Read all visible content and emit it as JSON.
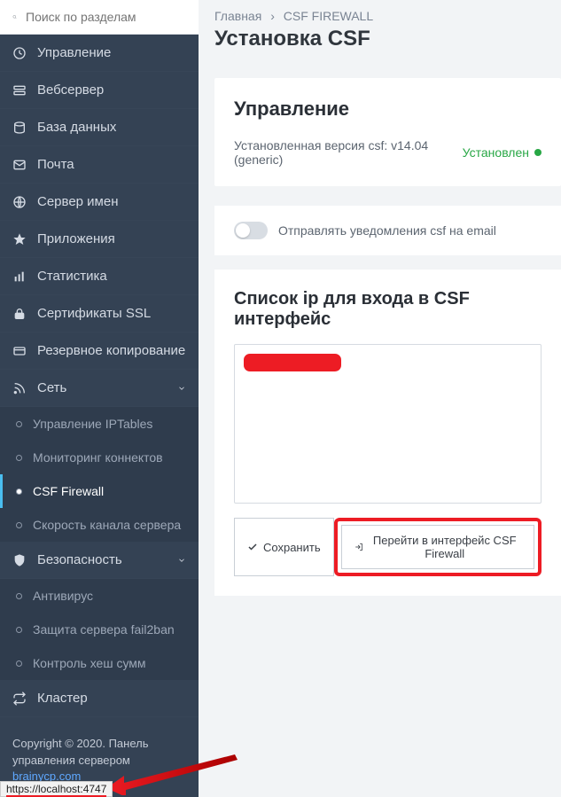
{
  "sidebar": {
    "search_placeholder": "Поиск по разделам",
    "items": [
      {
        "label": "Управление"
      },
      {
        "label": "Вебсервер"
      },
      {
        "label": "База данных"
      },
      {
        "label": "Почта"
      },
      {
        "label": "Сервер имен"
      },
      {
        "label": "Приложения"
      },
      {
        "label": "Статистика"
      },
      {
        "label": "Сертификаты SSL"
      },
      {
        "label": "Резервное копирование"
      }
    ],
    "network": {
      "label": "Сеть",
      "sub": [
        {
          "label": "Управление IPTables"
        },
        {
          "label": "Мониторинг коннектов"
        },
        {
          "label": "CSF Firewall"
        },
        {
          "label": "Скорость канала сервера"
        }
      ]
    },
    "security": {
      "label": "Безопасность",
      "sub": [
        {
          "label": "Антивирус"
        },
        {
          "label": "Защита сервера fail2ban"
        },
        {
          "label": "Контроль хеш сумм"
        }
      ]
    },
    "cluster": {
      "label": "Кластер"
    }
  },
  "footer": {
    "copyright": "Copyright © 2020. Панель управления сервером",
    "link": "brainycp.com"
  },
  "crumbs": {
    "home": "Главная",
    "current": "CSF FIREWALL"
  },
  "title": "Установка CSF",
  "mgmt": {
    "heading": "Управление",
    "version_label": "Установленная версия csf: v14.04 (generic)",
    "status": "Установлен"
  },
  "toggle": {
    "label": "Отправлять уведомления csf на email"
  },
  "iplist": {
    "heading": "Список ip для входа в CSF интерфейс"
  },
  "buttons": {
    "save": "Сохранить",
    "goto": "Перейти в интерфейс CSF Firewall"
  },
  "url_tip": "https://localhost:4747"
}
